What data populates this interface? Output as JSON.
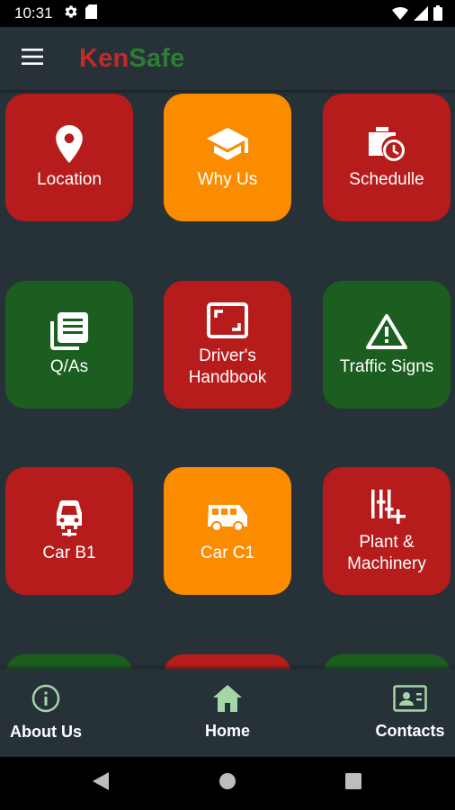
{
  "status_bar": {
    "time": "10:31"
  },
  "app_bar": {
    "brand_part1": "Ken",
    "brand_part2": "Safe"
  },
  "tiles": [
    {
      "label": "Location",
      "color": "red",
      "icon": "location-pin-icon"
    },
    {
      "label": "Why Us",
      "color": "orange",
      "icon": "graduation-cap-icon"
    },
    {
      "label": "Schedulle",
      "color": "red",
      "icon": "schedule-clock-icon"
    },
    {
      "label": "Q/As",
      "color": "green",
      "icon": "library-books-icon"
    },
    {
      "label": "Driver's\nHandbook",
      "color": "red",
      "icon": "aspect-ratio-icon"
    },
    {
      "label": "Traffic Signs",
      "color": "green",
      "icon": "warning-triangle-icon"
    },
    {
      "label": "Car B1",
      "color": "red",
      "icon": "car-icon"
    },
    {
      "label": "Car C1",
      "color": "orange",
      "icon": "van-icon"
    },
    {
      "label": "Plant &\nMachinery",
      "color": "red",
      "icon": "machinery-sliders-icon"
    }
  ],
  "bottom_nav": [
    {
      "label": "About Us",
      "icon": "info-icon"
    },
    {
      "label": "Home",
      "icon": "home-icon"
    },
    {
      "label": "Contacts",
      "icon": "contact-card-icon"
    }
  ],
  "colors": {
    "background": "#263238",
    "red": "#b71c1c",
    "green": "#1b5e20",
    "orange": "#fb8c00",
    "accent_icon": "#a5d6a7"
  }
}
